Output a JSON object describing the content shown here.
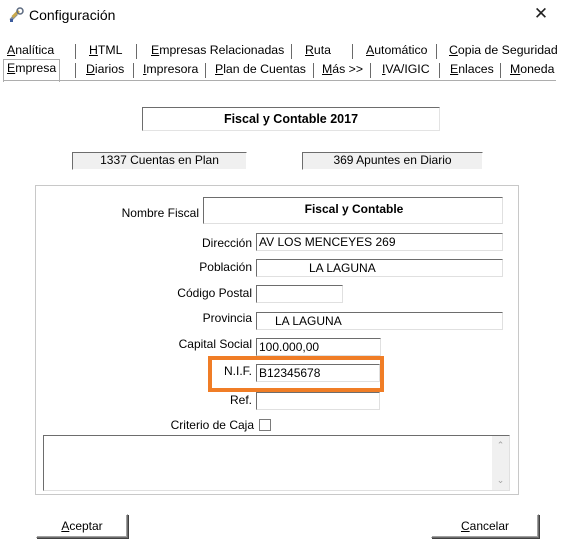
{
  "window": {
    "title": "Configuración",
    "close_glyph": "✕",
    "icon": "wrench-screwdriver-icon"
  },
  "tabs_row1": [
    {
      "label": "Analítica",
      "underline": "A"
    },
    {
      "label": "HTML",
      "underline": "H"
    },
    {
      "label": "Empresas Relacionadas",
      "underline": "E"
    },
    {
      "label": "Ruta",
      "underline": "R"
    },
    {
      "label": "Automático",
      "underline": "A"
    },
    {
      "label": "Copia de Seguridad",
      "underline": "C"
    }
  ],
  "tabs_row2": [
    {
      "label": "Empresa",
      "underline": "E",
      "active": true
    },
    {
      "label": "Diarios",
      "underline": "D"
    },
    {
      "label": "Impresora",
      "underline": "I"
    },
    {
      "label": "Plan de Cuentas",
      "underline": "P"
    },
    {
      "label": "Más >>",
      "underline": "M"
    },
    {
      "label": "IVA/IGIC",
      "underline": "I"
    },
    {
      "label": "Enlaces",
      "underline": "E"
    },
    {
      "label": "Moneda",
      "underline": "M"
    }
  ],
  "header": {
    "company_title": "Fiscal y Contable 2017",
    "accounts_count": "1337 Cuentas en Plan",
    "entries_count": "369 Apuntes en Diario"
  },
  "form": {
    "nombre_fiscal_label": "Nombre Fiscal",
    "nombre_fiscal_value": "Fiscal y Contable",
    "direccion_label": "Dirección",
    "direccion_value": "AV LOS MENCEYES 269",
    "poblacion_label": "Población",
    "poblacion_value": "LA LAGUNA",
    "codigo_postal_label": "Código Postal",
    "codigo_postal_value": "",
    "provincia_label": "Provincia",
    "provincia_value": "LA LAGUNA",
    "capital_social_label": "Capital Social",
    "capital_social_value": "100.000,00",
    "nif_label": "N.I.F.",
    "nif_value": "B12345678",
    "ref_label": "Ref.",
    "ref_value": "",
    "criterio_caja_label": "Criterio de Caja",
    "criterio_caja_checked": false,
    "memo_value": ""
  },
  "buttons": {
    "accept_label": "Aceptar",
    "cancel_label": "Cancelar"
  },
  "colors": {
    "highlight": "#f07d26"
  }
}
